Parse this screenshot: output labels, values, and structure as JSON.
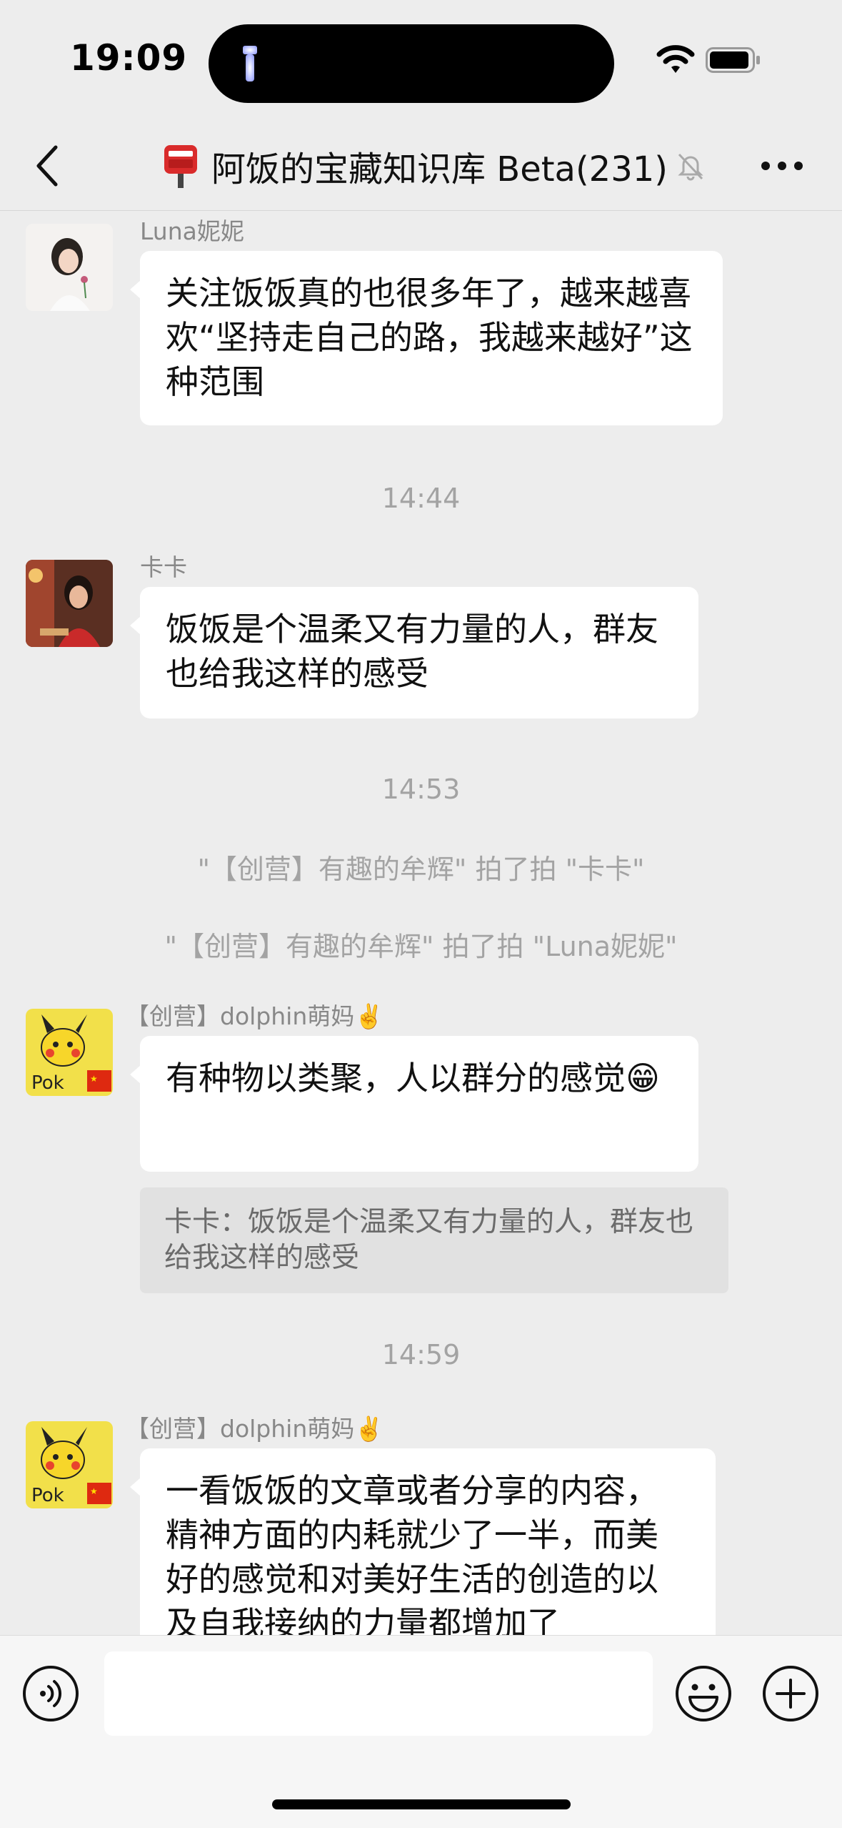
{
  "status_bar": {
    "time": "19:09"
  },
  "header": {
    "title": "阿饭的宝藏知识库 Beta(231)"
  },
  "messages": [
    {
      "sender": "Luna妮妮",
      "text": "关注饭饭真的也很多年了，越来越喜欢“坚持走自己的路，我越来越好”这种范围"
    },
    {
      "time": "14:44"
    },
    {
      "sender": "卡卡",
      "text": "饭饭是个温柔又有力量的人，群友也给我这样的感受"
    },
    {
      "time": "14:53"
    },
    {
      "system": "\"【创营】有趣的牟辉\" 拍了拍 \"卡卡\""
    },
    {
      "system": "\"【创营】有趣的牟辉\" 拍了拍 \"Luna妮妮\""
    },
    {
      "sender": "【创营】dolphin萌妈✌️",
      "text": "有种物以类聚，人以群分的感觉😁",
      "quote": "卡卡：饭饭是个温柔又有力量的人，群友也给我这样的感受"
    },
    {
      "time": "14:59"
    },
    {
      "sender": "【创营】dolphin萌妈✌️",
      "text": "一看饭饭的文章或者分享的内容，精神方面的内耗就少了一半，而美好的感觉和对美好生活的创造的以及自我接纳的力量都增加了"
    }
  ],
  "input": {
    "value": ""
  },
  "colors": {
    "background": "#ededed",
    "bubble": "#ffffff",
    "timestamp": "#a3a3a3",
    "sender": "#888888",
    "quote_bg": "#e1e1e1"
  },
  "icons": [
    "back-icon",
    "mailbox-icon",
    "mute-bell-icon",
    "more-icon",
    "voice-icon",
    "emoji-icon",
    "plus-icon",
    "wifi-icon",
    "battery-icon",
    "flashlight-icon"
  ]
}
